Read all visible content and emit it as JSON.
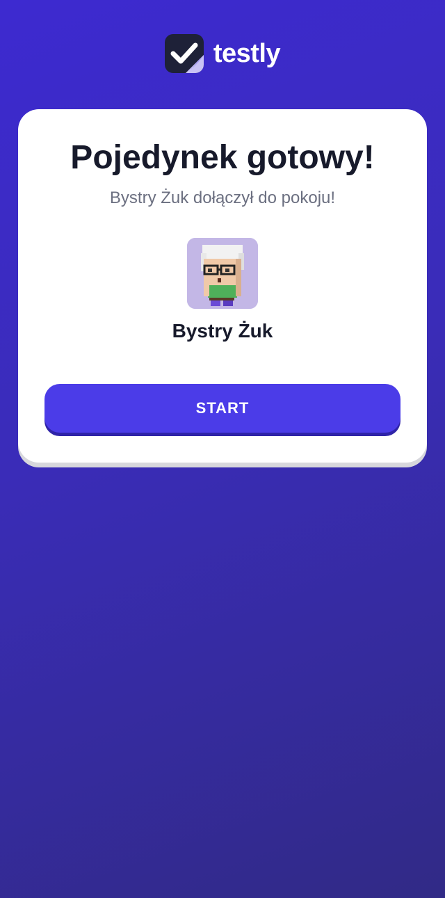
{
  "brand": {
    "name": "testly",
    "icon": "check-sticky-note-icon"
  },
  "card": {
    "title": "Pojedynek gotowy!",
    "subtitle": "Bystry Żuk dołączył do pokoju!",
    "player": {
      "name": "Bystry Żuk",
      "avatar": "voxel-character-avatar"
    },
    "start_label": "START"
  },
  "colors": {
    "background": "#3a2cb8",
    "accent": "#4b3ce8",
    "avatar_bg": "#c3b7e6"
  }
}
